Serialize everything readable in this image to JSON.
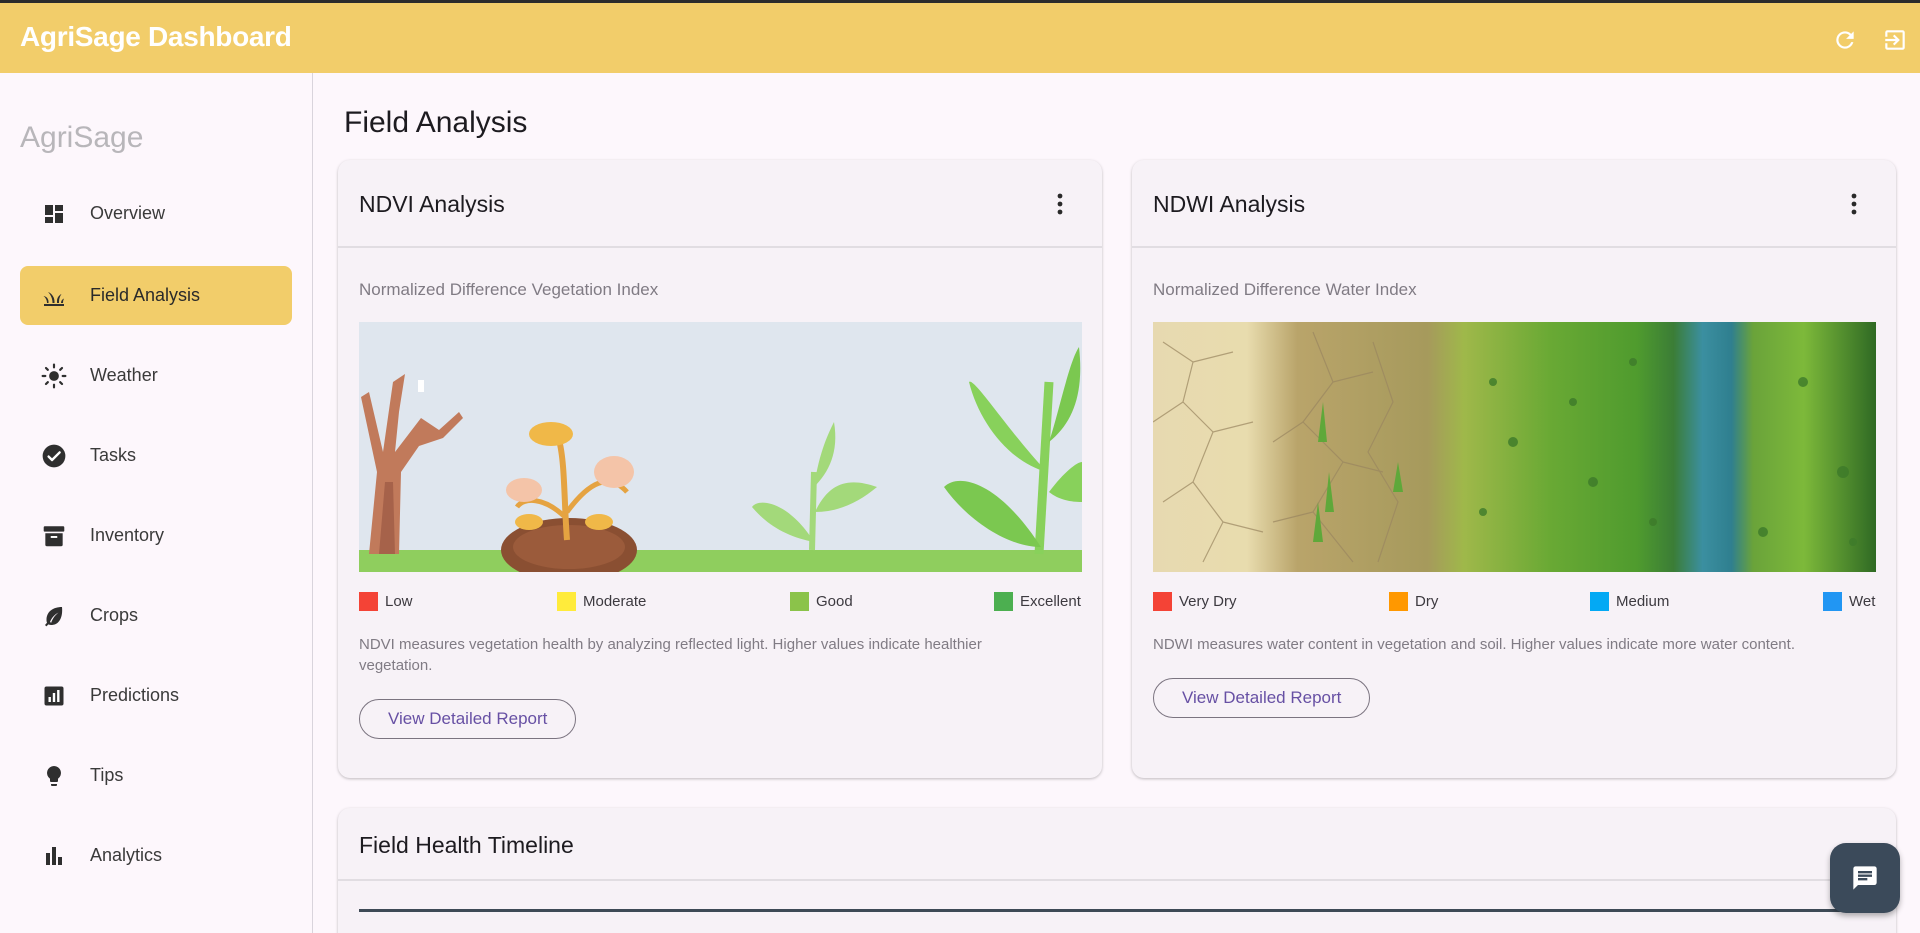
{
  "topbar": {
    "title": "AgriSage Dashboard",
    "refresh_icon": "refresh-icon",
    "logout_icon": "logout-icon",
    "bg_color": "#f2cd6a"
  },
  "sidebar": {
    "brand": "AgriSage",
    "items": [
      {
        "label": "Overview",
        "icon": "dashboard-icon",
        "active": false
      },
      {
        "label": "Field Analysis",
        "icon": "grass-icon",
        "active": true
      },
      {
        "label": "Weather",
        "icon": "sun-icon",
        "active": false
      },
      {
        "label": "Tasks",
        "icon": "check-circle-icon",
        "active": false
      },
      {
        "label": "Inventory",
        "icon": "archive-icon",
        "active": false
      },
      {
        "label": "Crops",
        "icon": "leaf-icon",
        "active": false
      },
      {
        "label": "Predictions",
        "icon": "insights-icon",
        "active": false
      },
      {
        "label": "Tips",
        "icon": "lightbulb-icon",
        "active": false
      },
      {
        "label": "Analytics",
        "icon": "bar-chart-icon",
        "active": false
      }
    ]
  },
  "main": {
    "page_title": "Field Analysis",
    "ndvi": {
      "title": "NDVI Analysis",
      "subtitle": "Normalized Difference Vegetation Index",
      "legend": [
        {
          "label": "Low",
          "color": "#f44336"
        },
        {
          "label": "Moderate",
          "color": "#ffeb3b"
        },
        {
          "label": "Good",
          "color": "#8bc34a"
        },
        {
          "label": "Excellent",
          "color": "#4caf50"
        }
      ],
      "description": "NDVI measures vegetation health by analyzing reflected light. Higher values indicate healthier vegetation.",
      "button": "View Detailed Report"
    },
    "ndwi": {
      "title": "NDWI Analysis",
      "subtitle": "Normalized Difference Water Index",
      "legend": [
        {
          "label": "Very Dry",
          "color": "#f44336"
        },
        {
          "label": "Dry",
          "color": "#ff9800"
        },
        {
          "label": "Medium",
          "color": "#03a9f4"
        },
        {
          "label": "Wet",
          "color": "#2196f3"
        }
      ],
      "description": "NDWI measures water content in vegetation and soil. Higher values indicate more water content.",
      "button": "View Detailed Report"
    },
    "timeline": {
      "title": "Field Health Timeline"
    }
  },
  "chat": {
    "icon": "chat-icon"
  }
}
